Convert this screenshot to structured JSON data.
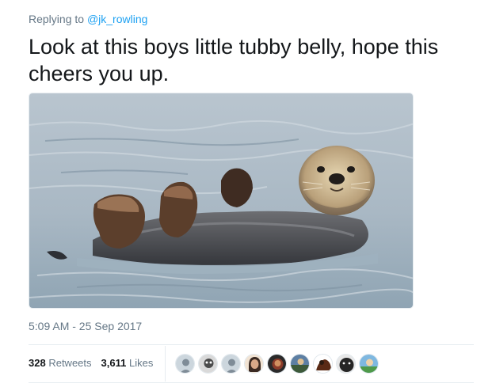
{
  "reply": {
    "prefix": "Replying to",
    "handle": "@jk_rowling"
  },
  "tweet": {
    "text": "Look at this boys little tubby belly, hope this cheers you up.",
    "timestamp": "5:09 AM - 25 Sep 2017"
  },
  "stats": {
    "retweets_count": "328",
    "retweets_label": "Retweets",
    "likes_count": "3,611",
    "likes_label": "Likes"
  },
  "likers": [
    {
      "icon": "default-avatar-icon"
    },
    {
      "icon": "user-avatar-icon"
    },
    {
      "icon": "default-avatar-icon"
    },
    {
      "icon": "user-avatar-icon"
    },
    {
      "icon": "user-avatar-icon"
    },
    {
      "icon": "user-avatar-icon"
    },
    {
      "icon": "user-avatar-icon"
    },
    {
      "icon": "user-avatar-icon"
    },
    {
      "icon": "user-avatar-icon"
    }
  ],
  "colors": {
    "link": "#1da1f2",
    "secondary_text": "#657786",
    "primary_text": "#14171a"
  }
}
